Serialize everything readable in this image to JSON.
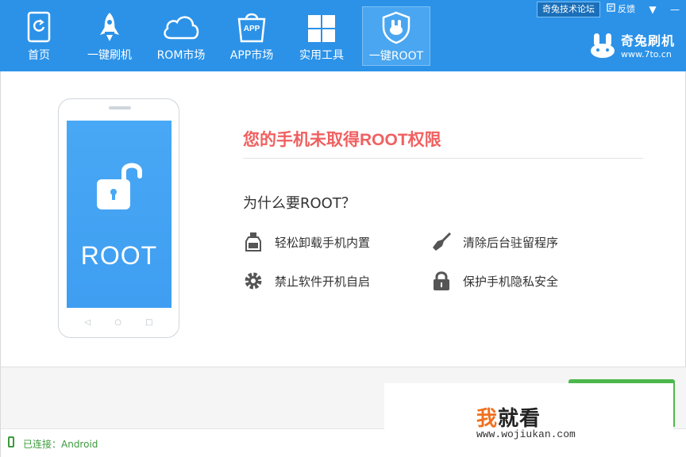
{
  "nav": [
    {
      "label": "首页",
      "icon": "home-phone-icon"
    },
    {
      "label": "一键刷机",
      "icon": "rocket-icon"
    },
    {
      "label": "ROM市场",
      "icon": "cloud-icon"
    },
    {
      "label": "APP市场",
      "icon": "app-bag-icon",
      "badge": "APP"
    },
    {
      "label": "实用工具",
      "icon": "windows-grid-icon"
    },
    {
      "label": "一键ROOT",
      "icon": "root-shield-icon",
      "active": true
    }
  ],
  "top_links": {
    "forum": "奇兔技术论坛",
    "feedback": "反馈",
    "dropdown": "▼",
    "minimize": "—"
  },
  "brand": {
    "name": "奇兔刷机",
    "url": "www.7to.cn"
  },
  "phone": {
    "screen_text": "ROOT"
  },
  "content": {
    "headline": "您的手机未取得ROOT权限",
    "why_title": "为什么要ROOT？",
    "features": [
      {
        "text": "轻松卸载手机内置",
        "icon": "uninstall-bottle-icon"
      },
      {
        "text": "清除后台驻留程序",
        "icon": "broom-icon"
      },
      {
        "text": "禁止软件开机自启",
        "icon": "gear-icon"
      },
      {
        "text": "保护手机隐私安全",
        "icon": "lock-icon"
      }
    ]
  },
  "status": {
    "connection": "已连接：Android"
  },
  "watermark": {
    "main_a": "我",
    "main_b": "就看",
    "sub": "www.wojiukan.com"
  },
  "colors": {
    "topbar": "#2b92e8",
    "headline": "#f06060",
    "status": "#3c9a3c",
    "green_button": "#4cb84c"
  }
}
